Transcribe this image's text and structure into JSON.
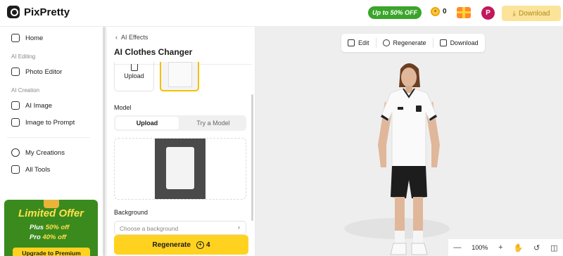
{
  "app": {
    "name": "PixPretty"
  },
  "topbar": {
    "promo": "Up to 50% OFF",
    "credits": "0",
    "avatar_initial": "P",
    "download_label": "Download"
  },
  "sidebar": {
    "home": "Home",
    "section_editing": "AI Editing",
    "photo_editor": "Photo Editor",
    "section_creation": "AI Creation",
    "ai_image": "AI Image",
    "image_to_prompt": "Image to Prompt",
    "my_creations": "My Creations",
    "all_tools": "All Tools",
    "offer": {
      "title": "Limited Offer",
      "plus_label": "Plus",
      "plus_pct": "50% off",
      "pro_label": "Pro",
      "pro_pct": "40% off",
      "button": "Upgrade to Premium"
    }
  },
  "panel": {
    "back_label": "AI Effects",
    "title": "AI Clothes Changer",
    "upload_label": "Upload",
    "model_label": "Model",
    "tab_upload": "Upload",
    "tab_try_model": "Try a Model",
    "background_label": "Background",
    "background_placeholder": "Choose a background",
    "regenerate_label": "Regenerate",
    "regenerate_cost": "4"
  },
  "canvas": {
    "toolbar": {
      "edit": "Edit",
      "regenerate": "Regenerate",
      "download": "Download"
    },
    "zoom": "100%"
  },
  "colors": {
    "accent": "#ffd21f",
    "promo_green": "#3aa52a",
    "avatar": "#c2185b"
  }
}
